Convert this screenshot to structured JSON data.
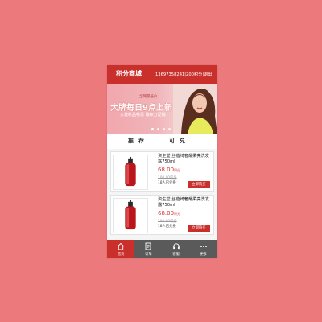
{
  "header": {
    "logo": "积分商城",
    "user_line": "13697358241|200积分|退出"
  },
  "banner": {
    "small_text": "全网最低价",
    "headline": "大牌每日9点上新",
    "subtext": "女装新品特惠 赚积分促销",
    "dots_count": 4,
    "active_dot": 0
  },
  "tabs": [
    {
      "label": "推荐"
    },
    {
      "label": "可兑"
    }
  ],
  "products": [
    {
      "name": "资生堂 丝蓓绮奢耀柔亮洗发露750ml",
      "price": "68.00",
      "unit": "积分",
      "old_price": "100.00积分",
      "sold": "18人已兑换",
      "button": "立即购买"
    },
    {
      "name": "资生堂 丝蓓绮奢耀柔亮洗发露750ml",
      "price": "68.00",
      "unit": "积分",
      "old_price": "100.00积分",
      "sold": "18人已兑换",
      "button": "立即购买"
    }
  ],
  "bottom_nav": [
    {
      "label": "首页",
      "icon": "home-icon",
      "active": true
    },
    {
      "label": "订单",
      "icon": "order-icon",
      "active": false
    },
    {
      "label": "客服",
      "icon": "headset-icon",
      "active": false
    },
    {
      "label": "更多",
      "icon": "more-icon",
      "active": false
    }
  ],
  "colors": {
    "accent": "#c9302c",
    "page_background": "#ec7a7d",
    "nav_background": "#5a5a5a"
  }
}
